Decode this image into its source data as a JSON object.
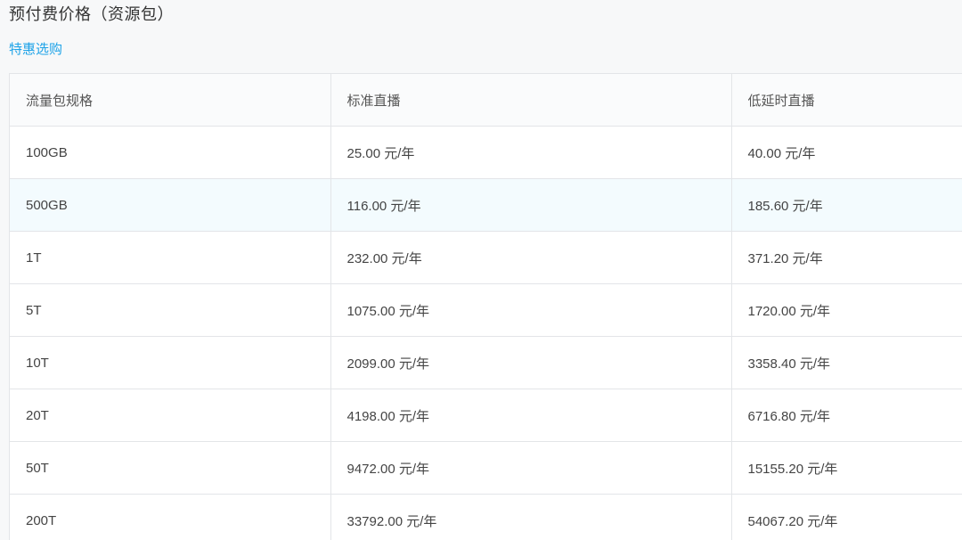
{
  "header": {
    "title": "预付费价格（资源包）",
    "promo_link": "特惠选购"
  },
  "table": {
    "columns": [
      "流量包规格",
      "标准直播",
      "低延时直播"
    ],
    "rows": [
      [
        "100GB",
        "25.00 元/年",
        "40.00 元/年"
      ],
      [
        "500GB",
        "116.00 元/年",
        "185.60 元/年"
      ],
      [
        "1T",
        "232.00 元/年",
        "371.20 元/年"
      ],
      [
        "5T",
        "1075.00 元/年",
        "1720.00 元/年"
      ],
      [
        "10T",
        "2099.00 元/年",
        "3358.40 元/年"
      ],
      [
        "20T",
        "4198.00 元/年",
        "6716.80 元/年"
      ],
      [
        "50T",
        "9472.00 元/年",
        "15155.20 元/年"
      ],
      [
        "200T",
        "33792.00 元/年",
        "54067.20 元/年"
      ]
    ]
  },
  "colors": {
    "link": "#1fa3e8",
    "highlight_row": "#f3fbfe",
    "border": "#e3e5e8"
  }
}
